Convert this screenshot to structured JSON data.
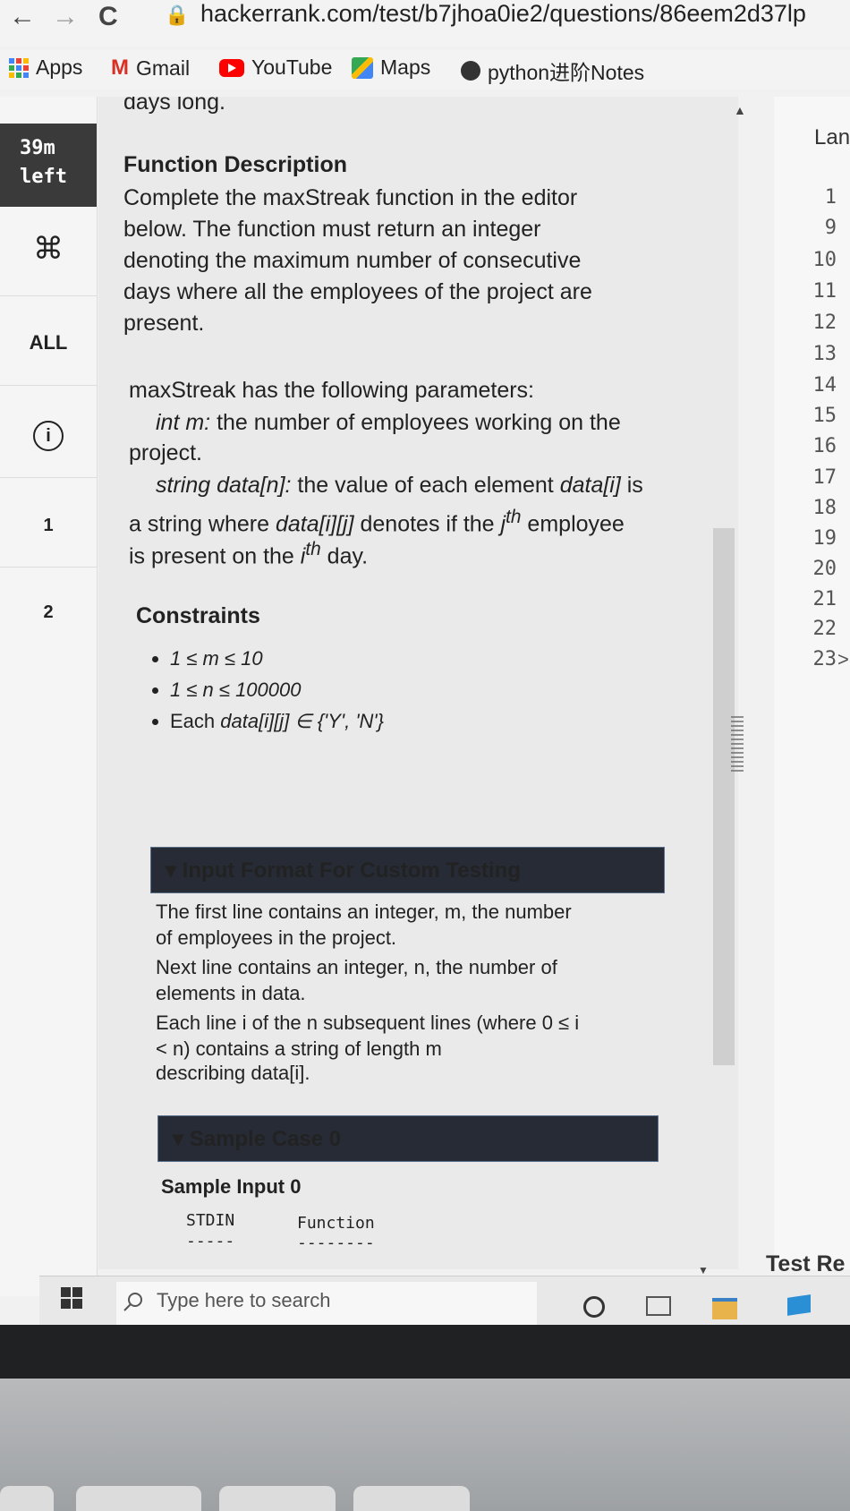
{
  "browser": {
    "back": "←",
    "forward": "→",
    "reload": "C",
    "url": "hackerrank.com/test/b7jhoa0ie2/questions/86eem2d37lp"
  },
  "bookmarks": [
    {
      "label": "Apps",
      "icon": "apps-grid-icon",
      "color": "#4285f4"
    },
    {
      "label": "Gmail",
      "icon": "gmail-icon",
      "color": "#d93025"
    },
    {
      "label": "YouTube",
      "icon": "youtube-icon",
      "color": "#ff0000"
    },
    {
      "label": "Maps",
      "icon": "maps-icon",
      "color": "#34a853"
    },
    {
      "label": "python进阶Notes",
      "icon": "globe-icon",
      "color": "#333333"
    }
  ],
  "left_nav": {
    "timer_value": "39m",
    "timer_suffix": "left",
    "cmd_symbol": "⌘",
    "all_label": "ALL",
    "info_symbol": "i",
    "question_1": "1",
    "question_2": "2"
  },
  "problem": {
    "top_cut": "days long.",
    "function_heading": "Function Description",
    "desc_lines": [
      "Complete the maxStreak function in the editor",
      "below. The function must return an integer",
      "denoting the maximum number of consecutive",
      "days where all the employees of the project are",
      "present."
    ],
    "params_intro": "maxStreak has the following parameters:",
    "param_m_name": "int m:",
    "param_m_desc": " the number of employees working on the",
    "param_m_desc2": "project.",
    "param_data_name": "string data[n]:",
    "param_data_desc": " the value of each element ",
    "param_data_elem": "data[i]",
    "param_data_is": " is",
    "param_data_line2a": "a string where ",
    "param_data_line2b": "data[i][j]",
    "param_data_line2c": " denotes if the ",
    "param_data_j": "j",
    "param_data_th": "th",
    "param_data_line2d": " employee",
    "param_data_line3a": "is present on the ",
    "param_data_i": "i",
    "param_data_th2": "th",
    "param_data_line3b": " day.",
    "constraints_heading": "Constraints",
    "constraints": [
      "1 ≤ m ≤ 10",
      "1 ≤ n ≤ 100000"
    ],
    "constraint_each_a": "Each ",
    "constraint_each_b": "data[i][j] ∈ {'Y', 'N'}",
    "input_format_heading": "▾ Input Format For Custom Testing",
    "input_format_lines": [
      "The first line contains an integer, m, the number",
      "of employees in the project.",
      "Next line contains an integer, n, the number of",
      "elements in data.",
      "Each line i of the n subsequent lines (where 0 ≤ i",
      "< n) contains a string of length m",
      "describing data[i]."
    ],
    "sample_case_heading": "▾ Sample Case 0",
    "sample_input_heading": "Sample Input 0",
    "stdin_label": "STDIN",
    "function_label": "Function",
    "stdin_dashes": "-----",
    "function_dashes": "--------"
  },
  "editor": {
    "language_label": "Lan",
    "line_numbers": [
      "1",
      "9",
      "10",
      "11",
      "12",
      "13",
      "14",
      "15",
      "16",
      "17",
      "18",
      "19",
      "20",
      "21",
      "22",
      "23"
    ],
    "expand_arrow": ">",
    "test_results_label": "Test Re"
  },
  "taskbar": {
    "search_placeholder": "Type here to search"
  }
}
